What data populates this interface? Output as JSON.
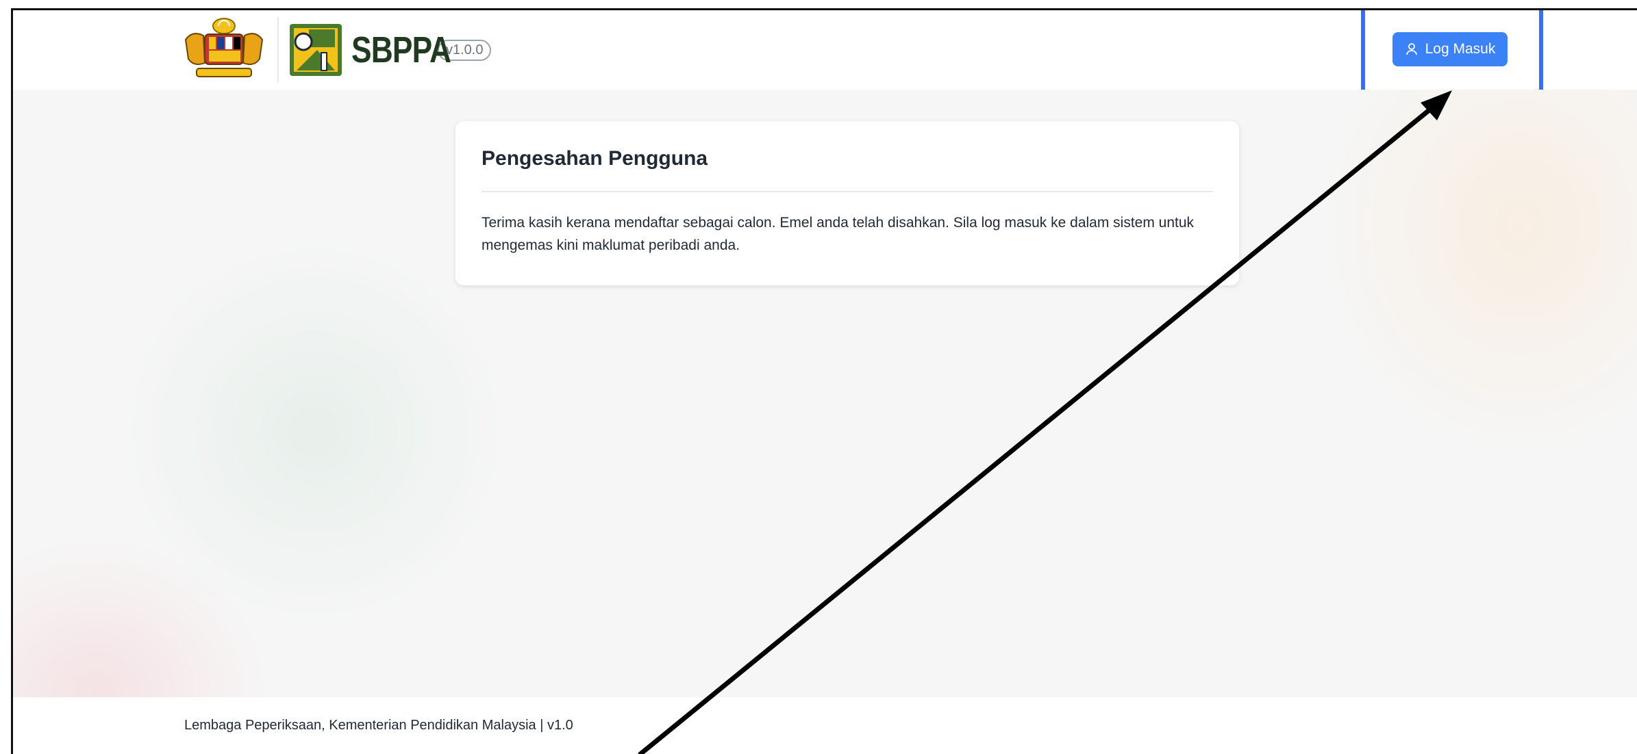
{
  "header": {
    "app_name": "SBPPA",
    "version": "v1.0.0",
    "login_label": "Log Masuk"
  },
  "card": {
    "title": "Pengesahan Pengguna",
    "message": "Terima kasih kerana mendaftar sebagai calon. Emel anda telah disahkan. Sila log masuk ke dalam sistem untuk mengemas kini maklumat peribadi anda."
  },
  "footer": {
    "text": "Lembaga Peperiksaan, Kementerian Pendidikan Malaysia | v1.0"
  },
  "colors": {
    "primary": "#3b82f6",
    "highlight": "#3b6cf6",
    "logo_green": "#4a7a2a",
    "logo_yellow": "#f2c21b"
  },
  "icons": {
    "crest": "malaysia-coat-of-arms-icon",
    "app_logo": "sbppa-logo-icon",
    "login": "user-icon"
  }
}
